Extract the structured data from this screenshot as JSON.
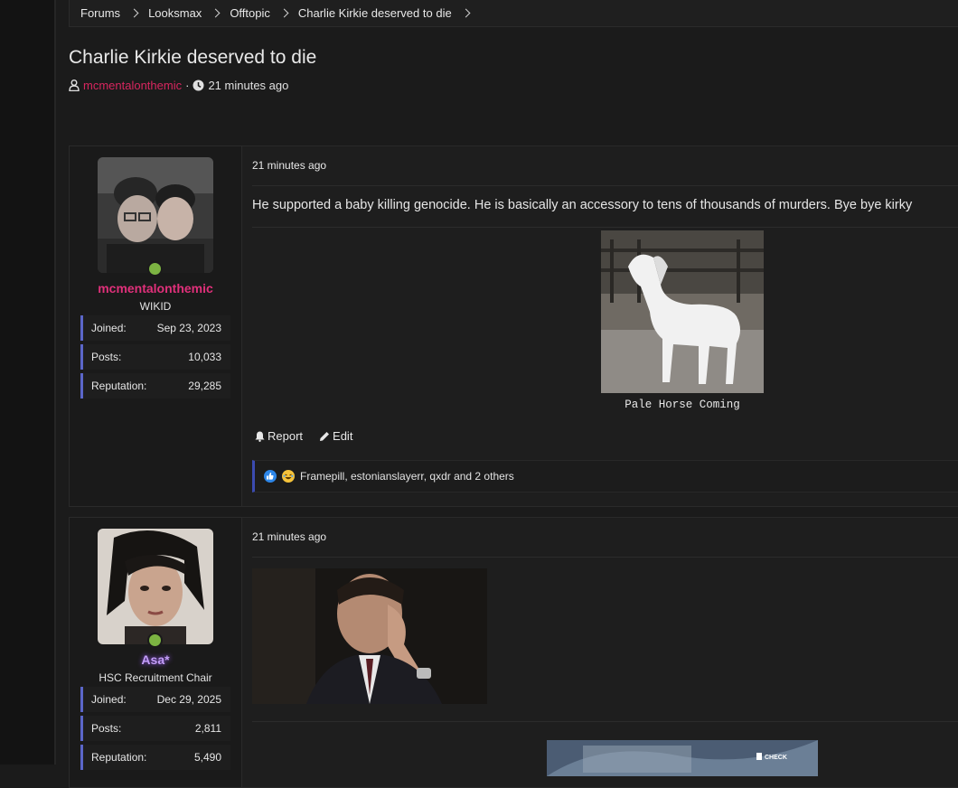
{
  "breadcrumb": [
    "Forums",
    "Looksmax",
    "Offtopic",
    "Charlie Kirkie deserved to die"
  ],
  "thread": {
    "title": "Charlie Kirkie deserved to die",
    "author": "mcmentalonthemic",
    "separator": "·",
    "time": "21 minutes ago"
  },
  "posts": [
    {
      "username": "mcmentalonthemic",
      "user_title": "WIKID",
      "stats": [
        {
          "label": "Joined:",
          "value": "Sep 23, 2023"
        },
        {
          "label": "Posts:",
          "value": "10,033"
        },
        {
          "label": "Reputation:",
          "value": "29,285"
        }
      ],
      "date": "21 minutes ago",
      "text": "He supported a baby killing genocide. He is basically an accessory to tens of thousands of murders. Bye bye kirky",
      "caption": "Pale Horse Coming",
      "actions": {
        "report": "Report",
        "edit": "Edit"
      },
      "reactions_text": "Framepill, estonianslayerr, qxdr and 2 others"
    },
    {
      "username": "Asa*",
      "user_title": "HSC Recruitment Chair",
      "stats": [
        {
          "label": "Joined:",
          "value": "Dec 29, 2025"
        },
        {
          "label": "Posts:",
          "value": "2,811"
        },
        {
          "label": "Reputation:",
          "value": "5,490"
        }
      ],
      "date": "21 minutes ago",
      "gif2_label": "CHECK"
    }
  ],
  "colors": {
    "author": "#d8265f",
    "online": "#7cb342",
    "stat_accent": "#5b66c9",
    "username2": "#c39df8"
  }
}
